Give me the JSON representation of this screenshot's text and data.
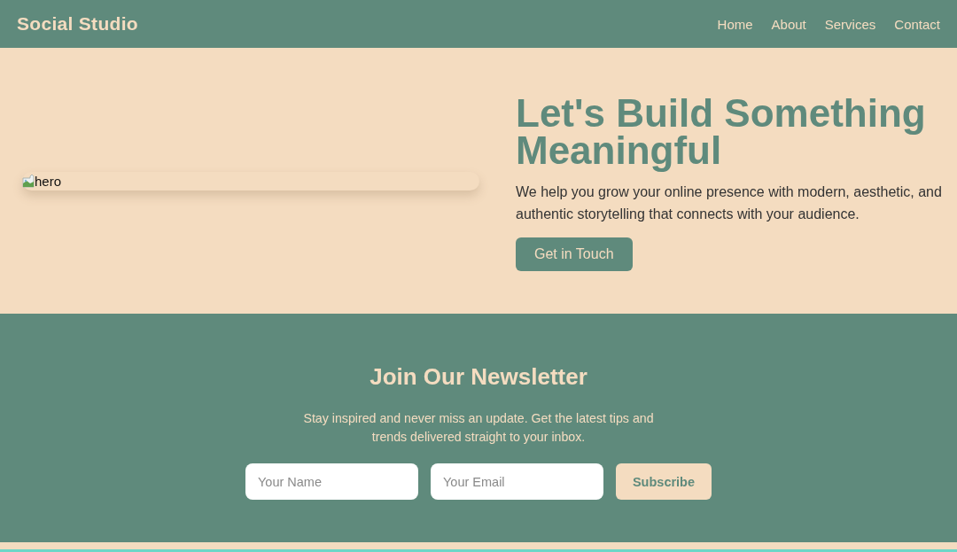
{
  "header": {
    "logo": "Social Studio",
    "nav": [
      "Home",
      "About",
      "Services",
      "Contact"
    ]
  },
  "hero": {
    "image_alt": "hero",
    "title": "Let's Build Something Meaningful",
    "text": "We help you grow your online presence with modern, aesthetic, and authentic storytelling that connects with your audience.",
    "button": "Get in Touch"
  },
  "newsletter": {
    "title": "Join Our Newsletter",
    "text": "Stay inspired and never miss an update. Get the latest tips and trends delivered straight to your inbox.",
    "fields": [
      {
        "placeholder": "Your Name"
      },
      {
        "placeholder": "Your Email"
      }
    ],
    "button": "Subscribe"
  }
}
